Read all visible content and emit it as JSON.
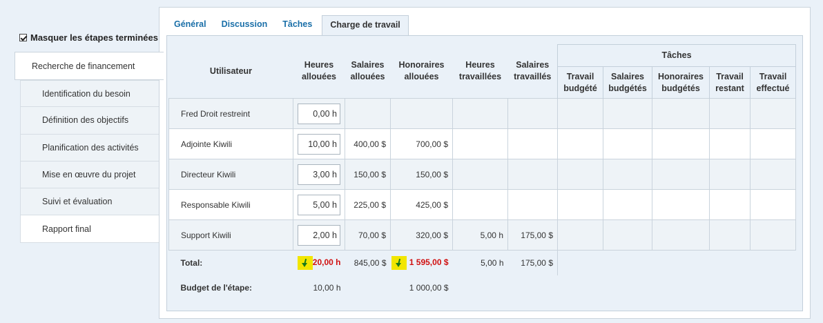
{
  "sidebar": {
    "hide_completed_label": "Masquer les étapes terminées",
    "steps": [
      "Recherche de financement",
      "Identification du besoin",
      "Définition des objectifs",
      "Planification des activités",
      "Mise en œuvre du projet",
      "Suivi et évaluation",
      "Rapport final"
    ]
  },
  "tabs": [
    "Général",
    "Discussion",
    "Tâches",
    "Charge de travail"
  ],
  "table": {
    "group_header": "Tâches",
    "headers": {
      "user": "Utilisateur",
      "hours_alloc": [
        "Heures",
        "allouées"
      ],
      "sal_alloc": [
        "Salaires",
        "allouées"
      ],
      "fees_alloc": [
        "Honoraires",
        "allouées"
      ],
      "hours_worked": [
        "Heures",
        "travaillées"
      ],
      "sal_worked": [
        "Salaires",
        "travaillés"
      ],
      "work_budget": [
        "Travail",
        "budgété"
      ],
      "sal_budget": [
        "Salaires",
        "budgétés"
      ],
      "fees_budget": [
        "Honoraires",
        "budgétés"
      ],
      "work_left": [
        "Travail",
        "restant"
      ],
      "work_done": [
        "Travail",
        "effectué"
      ]
    },
    "rows": [
      {
        "user": "Fred Droit restreint",
        "hours": "0,00 h",
        "sal": "",
        "fees": "",
        "hw": "",
        "sw": ""
      },
      {
        "user": "Adjointe Kiwili",
        "hours": "10,00 h",
        "sal": "400,00 $",
        "fees": "700,00 $",
        "hw": "",
        "sw": ""
      },
      {
        "user": "Directeur Kiwili",
        "hours": "3,00 h",
        "sal": "150,00 $",
        "fees": "150,00 $",
        "hw": "",
        "sw": ""
      },
      {
        "user": "Responsable Kiwili",
        "hours": "5,00 h",
        "sal": "225,00 $",
        "fees": "425,00 $",
        "hw": "",
        "sw": ""
      },
      {
        "user": "Support Kiwili",
        "hours": "2,00 h",
        "sal": "70,00 $",
        "fees": "320,00 $",
        "hw": "5,00 h",
        "sw": "175,00 $"
      }
    ],
    "total": {
      "label": "Total:",
      "hours": "20,00 h",
      "sal": "845,00 $",
      "fees": "1 595,00 $",
      "hw": "5,00 h",
      "sw": "175,00 $"
    },
    "budget": {
      "label": "Budget de l'étape:",
      "hours": "10,00 h",
      "fees": "1 000,00 $"
    }
  },
  "colors": {
    "accent": "#1a6fa8",
    "over_budget": "#d01010",
    "highlight": "#f2e600"
  }
}
